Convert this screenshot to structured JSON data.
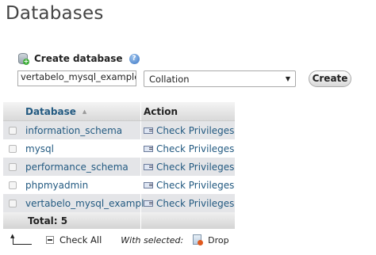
{
  "page_title": "Databases",
  "create": {
    "heading": "Create database",
    "db_name_value": "vertabelo_mysql_example",
    "collation_value": "Collation",
    "create_label": "Create"
  },
  "table": {
    "col_database": "Database",
    "col_action": "Action",
    "rows": [
      {
        "name": "information_schema",
        "action": "Check Privileges"
      },
      {
        "name": "mysql",
        "action": "Check Privileges"
      },
      {
        "name": "performance_schema",
        "action": "Check Privileges"
      },
      {
        "name": "phpmyadmin",
        "action": "Check Privileges"
      },
      {
        "name": "vertabelo_mysql_example",
        "action": "Check Privileges"
      }
    ],
    "total_label": "Total: 5"
  },
  "footer": {
    "check_all": "Check All",
    "with_selected": "With selected:",
    "drop": "Drop"
  }
}
